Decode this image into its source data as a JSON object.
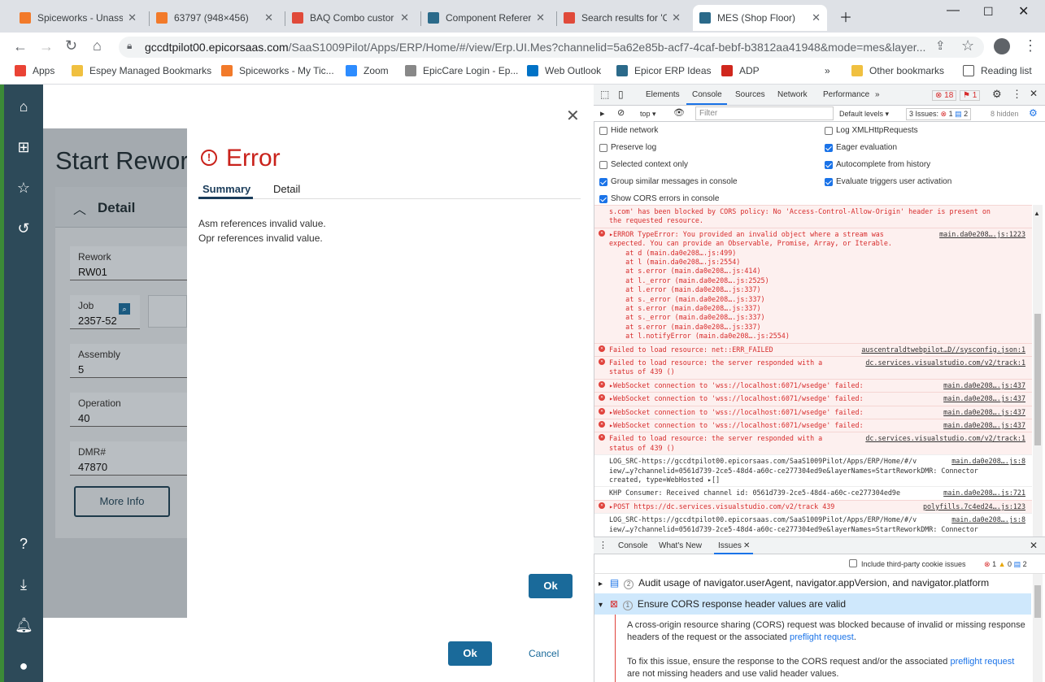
{
  "browser": {
    "tabs": [
      {
        "title": "Spiceworks - Unassi",
        "color": "#f27a2a"
      },
      {
        "title": "63797 (948×456)",
        "color": "#f27a2a"
      },
      {
        "title": "BAQ Combo custor",
        "color": "#e04a3a"
      },
      {
        "title": "Component Referer",
        "color": "#2b6a8a"
      },
      {
        "title": "Search results for 'C",
        "color": "#e04a3a"
      },
      {
        "title": "MES (Shop Floor)",
        "color": "#2b6a8a"
      }
    ],
    "url_host": "gccdtpilot00.epicorsaas.com",
    "url_path": "/SaaS1009Pilot/Apps/ERP/Home/#/view/Erp.UI.Mes?channelid=5a62e85b-acf7-4caf-bebf-b3812aa41948&mode=mes&layer...",
    "bookmarks": [
      "Apps",
      "Espey Managed Bookmarks",
      "Spiceworks - My Tic...",
      "Zoom",
      "EpicCare Login - Ep...",
      "Web Outlook",
      "Epicor ERP Ideas",
      "ADP"
    ],
    "bookmark_right": [
      "Other bookmarks",
      "Reading list"
    ]
  },
  "mes": {
    "page_title": "Start Rewor",
    "detail_label": "Detail",
    "fields": [
      {
        "label": "Rework",
        "value": "RW01"
      },
      {
        "label": "Job",
        "value": "2357-52"
      },
      {
        "label": "Assembly",
        "value": "5"
      },
      {
        "label": "Operation",
        "value": "40"
      },
      {
        "label": "DMR#",
        "value": "47870"
      }
    ],
    "more_info": "More Info",
    "ok": "Ok",
    "cancel": "Cancel"
  },
  "error_dialog": {
    "title": "Error",
    "tabs": [
      "Summary",
      "Detail"
    ],
    "messages": [
      "Asm references invalid value.",
      "Opr references invalid value."
    ],
    "ok": "Ok"
  },
  "devtools": {
    "tabs": [
      "Elements",
      "Console",
      "Sources",
      "Network",
      "Performance"
    ],
    "error_count": "18",
    "warn_count": "1",
    "context": "top",
    "filter_placeholder": "Filter",
    "levels": "Default levels",
    "issues_summary": "3 Issues:",
    "issues_err": "1",
    "issues_warn": "2",
    "hidden": "8 hidden",
    "settings_left": [
      {
        "label": "Hide network",
        "checked": false
      },
      {
        "label": "Preserve log",
        "checked": false
      },
      {
        "label": "Selected context only",
        "checked": false
      },
      {
        "label": "Group similar messages in console",
        "checked": true
      },
      {
        "label": "Show CORS errors in console",
        "checked": true
      }
    ],
    "settings_right": [
      {
        "label": "Log XMLHttpRequests",
        "checked": false
      },
      {
        "label": "Eager evaluation",
        "checked": true
      },
      {
        "label": "Autocomplete from history",
        "checked": true
      },
      {
        "label": "Evaluate triggers user activation",
        "checked": true
      }
    ],
    "console_rows": [
      {
        "kind": "err",
        "icon": false,
        "text": "s.com' has been blocked by CORS policy: No 'Access-Control-Allow-Origin' header is present on\nthe requested resource.",
        "src": ""
      },
      {
        "kind": "err",
        "icon": true,
        "text": "▸ERROR TypeError: You provided an invalid object where a stream was\nexpected. You can provide an Observable, Promise, Array, or Iterable.\n    at d (main.da0e208….js:499)\n    at l (main.da0e208….js:2554)\n    at s.error (main.da0e208….js:414)\n    at l._error (main.da0e208….js:2525)\n    at l.error (main.da0e208….js:337)\n    at s._error (main.da0e208….js:337)\n    at s.error (main.da0e208….js:337)\n    at s._error (main.da0e208….js:337)\n    at s.error (main.da0e208….js:337)\n    at l.notifyError (main.da0e208….js:2554)",
        "src": "main.da0e208….js:1223"
      },
      {
        "kind": "err",
        "icon": true,
        "text": "Failed to load resource: net::ERR_FAILED",
        "src": "auscentraldtwebpilot…D//sysconfig.json:1"
      },
      {
        "kind": "err",
        "icon": true,
        "text": "Failed to load resource: the server responded with a\nstatus of 439 ()",
        "src": "dc.services.visualstudio.com/v2/track:1"
      },
      {
        "kind": "err",
        "icon": true,
        "text": "▸WebSocket connection to 'wss://localhost:6071/wsedge' failed:",
        "src": "main.da0e208….js:437"
      },
      {
        "kind": "err",
        "icon": true,
        "text": "▸WebSocket connection to 'wss://localhost:6071/wsedge' failed:",
        "src": "main.da0e208….js:437"
      },
      {
        "kind": "err",
        "icon": true,
        "text": "▸WebSocket connection to 'wss://localhost:6071/wsedge' failed:",
        "src": "main.da0e208….js:437"
      },
      {
        "kind": "err",
        "icon": true,
        "text": "▸WebSocket connection to 'wss://localhost:6071/wsedge' failed:",
        "src": "main.da0e208….js:437"
      },
      {
        "kind": "err",
        "icon": true,
        "text": "Failed to load resource: the server responded with a\nstatus of 439 ()",
        "src": "dc.services.visualstudio.com/v2/track:1"
      },
      {
        "kind": "log",
        "icon": false,
        "text": "LOG_SRC-https://gccdtpilot00.epicorsaas.com/SaaS1009Pilot/Apps/ERP/Home/#/v\niew/…y?channelid=0561d739-2ce5-48d4-a60c-ce277304ed9e&layerNames=StartReworkDMR: Connector\ncreated, type=WebHosted ▸[]",
        "src": "main.da0e208….js:8"
      },
      {
        "kind": "log",
        "icon": false,
        "text": "KHP Consumer: Received channel id: 0561d739-2ce5-48d4-a60c-ce277304ed9e",
        "src": "main.da0e208….js:721"
      },
      {
        "kind": "err",
        "icon": true,
        "text": "▸POST https://dc.services.visualstudio.com/v2/track 439",
        "src": "polyfills.7c4ed24….js:123"
      },
      {
        "kind": "log",
        "icon": false,
        "text": "LOG_SRC-https://gccdtpilot00.epicorsaas.com/SaaS1009Pilot/Apps/ERP/Home/#/v\niew/…y?channelid=0561d739-2ce5-48d4-a60c-ce277304ed9e&layerNames=StartReworkDMR: Connector",
        "src": "main.da0e208….js:8"
      }
    ],
    "drawer_tabs": [
      "Console",
      "What's New",
      "Issues"
    ],
    "third_party": "Include third-party cookie issues",
    "drawer_counts": {
      "err": "1",
      "warn": "0",
      "info": "2"
    },
    "issues": [
      {
        "count": "2",
        "title": "Audit usage of navigator.userAgent, navigator.appVersion, and navigator.platform"
      },
      {
        "count": "1",
        "title": "Ensure CORS response header values are valid"
      }
    ],
    "issue_body_1a": "A cross-origin resource sharing (CORS) request was blocked because of invalid or missing response headers of the request or the associated ",
    "issue_body_1b": "preflight request",
    "issue_body_1c": ".",
    "issue_body_2a": "To fix this issue, ensure the response to the CORS request and/or the associated ",
    "issue_body_2b": "preflight request",
    "issue_body_2c": " are not missing headers and use valid header values."
  }
}
